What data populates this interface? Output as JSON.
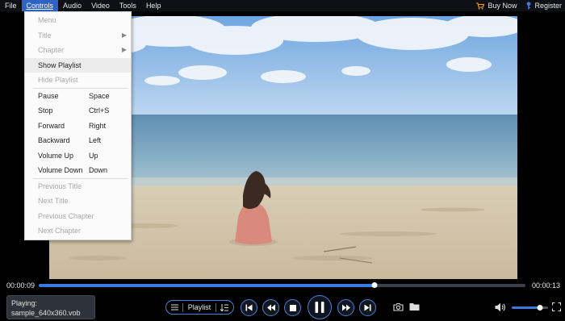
{
  "menubar": {
    "items": [
      {
        "label": "File",
        "active": false
      },
      {
        "label": "Controls",
        "active": true
      },
      {
        "label": "Audio",
        "active": false
      },
      {
        "label": "Video",
        "active": false
      },
      {
        "label": "Tools",
        "active": false
      },
      {
        "label": "Help",
        "active": false
      }
    ],
    "buy_now": "Buy Now",
    "register": "Register"
  },
  "controls_menu": {
    "items": [
      {
        "label": "Menu",
        "shortcut": "",
        "enabled": false
      },
      {
        "label": "Title",
        "shortcut": "",
        "enabled": false,
        "submenu": true
      },
      {
        "label": "Chapter",
        "shortcut": "",
        "enabled": false,
        "submenu": true
      },
      {
        "label": "Show Playlist",
        "shortcut": "",
        "enabled": true,
        "hover": true
      },
      {
        "label": "Hide Playlist",
        "shortcut": "",
        "enabled": false
      },
      {
        "label": "Pause",
        "shortcut": "Space",
        "enabled": true
      },
      {
        "label": "Stop",
        "shortcut": "Ctrl+S",
        "enabled": true
      },
      {
        "label": "Forward",
        "shortcut": "Right",
        "enabled": true
      },
      {
        "label": "Backward",
        "shortcut": "Left",
        "enabled": true
      },
      {
        "label": "Volume Up",
        "shortcut": "Up",
        "enabled": true
      },
      {
        "label": "Volume Down",
        "shortcut": "Down",
        "enabled": true
      },
      {
        "label": "Previous Title",
        "shortcut": "",
        "enabled": false
      },
      {
        "label": "Next Title",
        "shortcut": "",
        "enabled": false
      },
      {
        "label": "Previous Chapter",
        "shortcut": "",
        "enabled": false
      },
      {
        "label": "Next Chapter",
        "shortcut": "",
        "enabled": false
      }
    ]
  },
  "playback": {
    "current_time": "00:00:09",
    "total_time": "00:00:13",
    "progress": 0.69
  },
  "now_playing": {
    "label": "Playing:",
    "file": "sample_640x360.vob"
  },
  "playlist_button": {
    "label": "Playlist"
  },
  "volume": {
    "level": 0.78
  },
  "colors": {
    "accent": "#3b7be0",
    "menubar_active": "#2f63c5",
    "buy_now_icon": "#f0a020",
    "register_icon": "#3b7be0"
  },
  "icons": {
    "buy_now": "cart-icon",
    "register": "key-icon",
    "playlist": "list-icon",
    "playlist_order": "sort-icon",
    "prev": "skip-previous-icon",
    "rewind": "rewind-icon",
    "stop": "stop-icon",
    "pause": "pause-icon",
    "forward": "fast-forward-icon",
    "next": "skip-next-icon",
    "snapshot": "camera-icon",
    "open": "folder-icon",
    "volume": "speaker-icon",
    "fullscreen": "fullscreen-icon"
  }
}
